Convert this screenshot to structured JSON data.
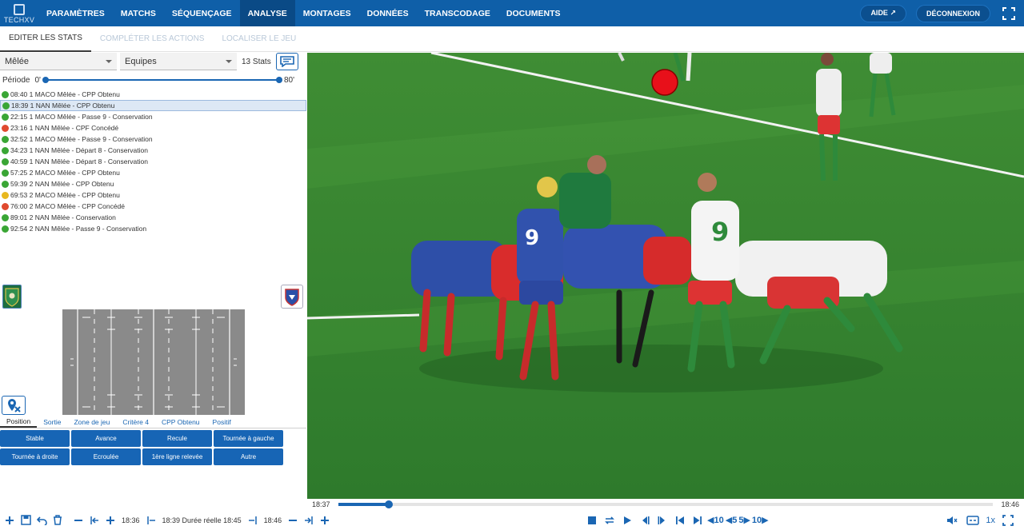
{
  "app": {
    "logo": "TECHXV",
    "nav": [
      "PARAMÈTRES",
      "MATCHS",
      "SÉQUENÇAGE",
      "ANALYSE",
      "MONTAGES",
      "DONNÉES",
      "TRANSCODAGE",
      "DOCUMENTS"
    ],
    "active_nav": "ANALYSE",
    "help_label": "AIDE ↗",
    "logout_label": "DÉCONNEXION"
  },
  "subtabs": [
    "EDITER LES STATS",
    "COMPLÉTER LES ACTIONS",
    "LOCALISER LE JEU"
  ],
  "filters": {
    "action": "Mêlée",
    "team": "Equipes",
    "stats_count": "13 Stats"
  },
  "periode": {
    "label": "Période",
    "min": "0'",
    "max": "80'"
  },
  "events": [
    {
      "text": "08:40 1 MACO Mêlée - CPP Obtenu",
      "color": "#3aa635"
    },
    {
      "text": "18:39 1 NAN Mêlée - CPP Obtenu",
      "color": "#3aa635",
      "selected": true
    },
    {
      "text": "22:15 1 MACO Mêlée - Passe 9 - Conservation",
      "color": "#3aa635"
    },
    {
      "text": "23:16 1 NAN Mêlée - CPF Concédé",
      "color": "#e04a2f"
    },
    {
      "text": "32:52 1 MACO Mêlée - Passe 9 - Conservation",
      "color": "#3aa635"
    },
    {
      "text": "34:23 1 NAN Mêlée - Départ 8 - Conservation",
      "color": "#3aa635"
    },
    {
      "text": "40:59 1 NAN Mêlée - Départ 8 - Conservation",
      "color": "#3aa635"
    },
    {
      "text": "57:25 2 MACO Mêlée - CPP Obtenu",
      "color": "#3aa635"
    },
    {
      "text": "59:39 2 NAN Mêlée - CPP Obtenu",
      "color": "#3aa635"
    },
    {
      "text": "69:53 2 MACO Mêlée - CPP Obtenu",
      "color": "#e8b820"
    },
    {
      "text": "76:00 2 MACO Mêlée - CPP Concédé",
      "color": "#e04a2f"
    },
    {
      "text": "89:01 2 NAN Mêlée - Conservation",
      "color": "#3aa635"
    },
    {
      "text": "92:54 2 NAN Mêlée - Passe 9 - Conservation",
      "color": "#3aa635"
    }
  ],
  "criteria_tabs": [
    "Position",
    "Sortie",
    "Zone de jeu",
    "Critère 4",
    "CPP Obtenu",
    "Positif"
  ],
  "action_buttons": [
    "Stable",
    "Avance",
    "Recule",
    "Tournée à gauche",
    "Tournée à droite",
    "Ecroulée",
    "1ère ligne relevée",
    "Autre"
  ],
  "timeline": {
    "start": "18:37",
    "end": "18:46",
    "progress": 0.078
  },
  "bottom": {
    "t1": "18:36",
    "t2": "18:39 Durée réelle 18:45",
    "t3": "18:46",
    "skip_back": "10",
    "skip_back_small": "5",
    "skip_fwd_small": "5",
    "skip_fwd": "10",
    "speed": "1x"
  }
}
